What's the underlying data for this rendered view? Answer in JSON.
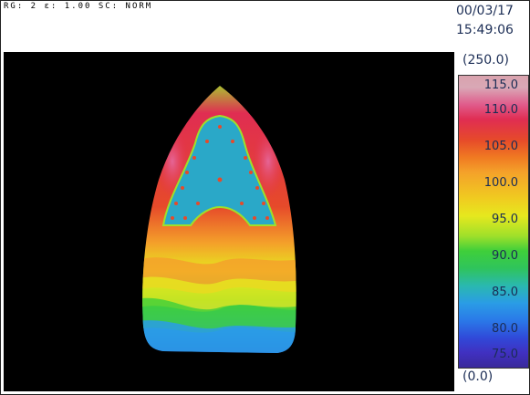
{
  "status_line": "RG: 2 ε: 1.00 SC: NORM",
  "date": "00/03/17",
  "time": "15:49:06",
  "scale": {
    "max_label": "(250.0)",
    "min_label": "(0.0)",
    "ticks": [
      "115.0",
      "110.0",
      "105.0",
      "100.0",
      "95.0",
      "90.0",
      "85.0",
      "80.0",
      "75.0"
    ]
  },
  "colors": {
    "hot": "#e02d52",
    "warm": "#f07a22",
    "mid": "#3fcf3a",
    "cool": "#2aa8d8",
    "cold": "#3a2a9a"
  }
}
